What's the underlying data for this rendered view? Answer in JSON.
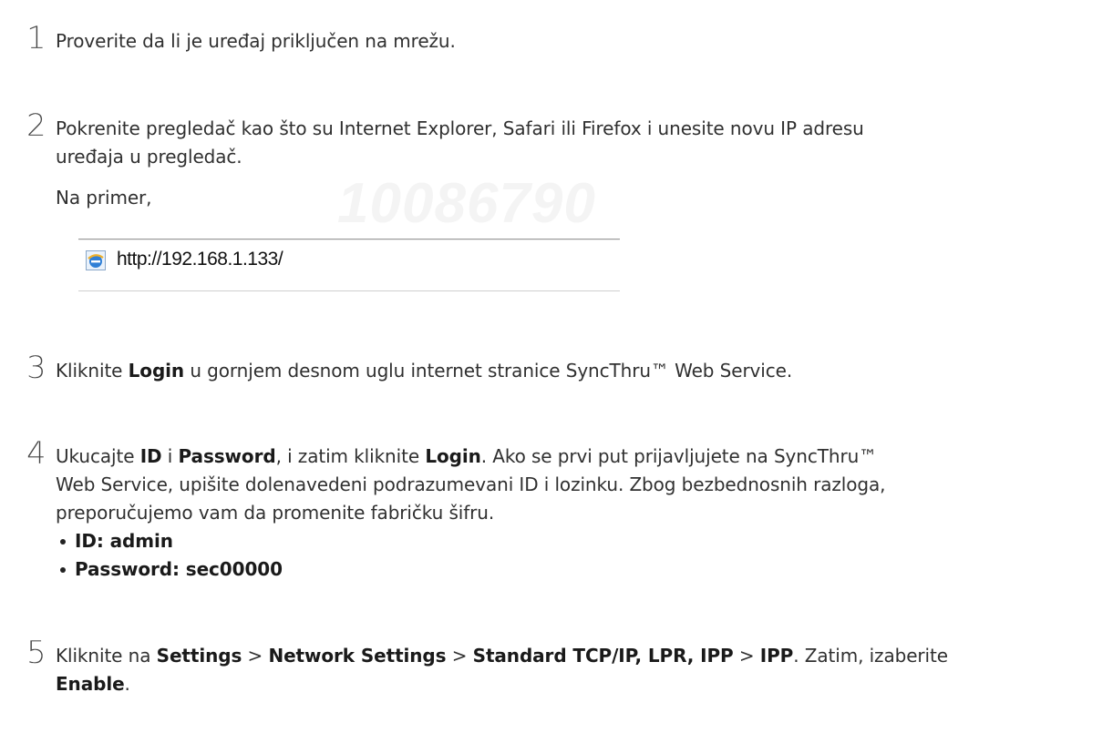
{
  "watermark": "10086790",
  "steps": [
    {
      "num": "1",
      "text": "Proverite da li je uređaj priključen na mrežu."
    },
    {
      "num": "2",
      "line1": "Pokrenite pregledač kao što su Internet Explorer, Safari ili Firefox i unesite novu IP adresu",
      "line2": "uređaja u pregledač.",
      "example_label": "Na primer,",
      "url_example": "http://192.168.1.133/"
    },
    {
      "num": "3",
      "pre": "Kliknite ",
      "bold": "Login",
      "post": " u gornjem desnom uglu internet stranice SyncThru™ Web Service."
    },
    {
      "num": "4",
      "a": "Ukucajte ",
      "b": "ID",
      "c": " i ",
      "d": "Password",
      "e": ", i zatim kliknite ",
      "f": "Login",
      "g": ". Ako se prvi put prijavljujete na SyncThru™",
      "line2": "Web Service, upišite dolenavedeni podrazumevani ID i lozinku. Zbog bezbednosnih razloga,",
      "line3": "preporučujemo vam da promenite fabričku šifru.",
      "bullets": [
        "ID: admin",
        "Password: sec00000"
      ]
    },
    {
      "num": "5",
      "pre": "Kliknite na ",
      "path": [
        "Settings",
        "Network Settings",
        "Standard TCP/IP, LPR, IPP",
        "IPP"
      ],
      "separator": " > ",
      "mid": ". Zatim, izaberite",
      "enable": "Enable",
      "end": "."
    }
  ]
}
